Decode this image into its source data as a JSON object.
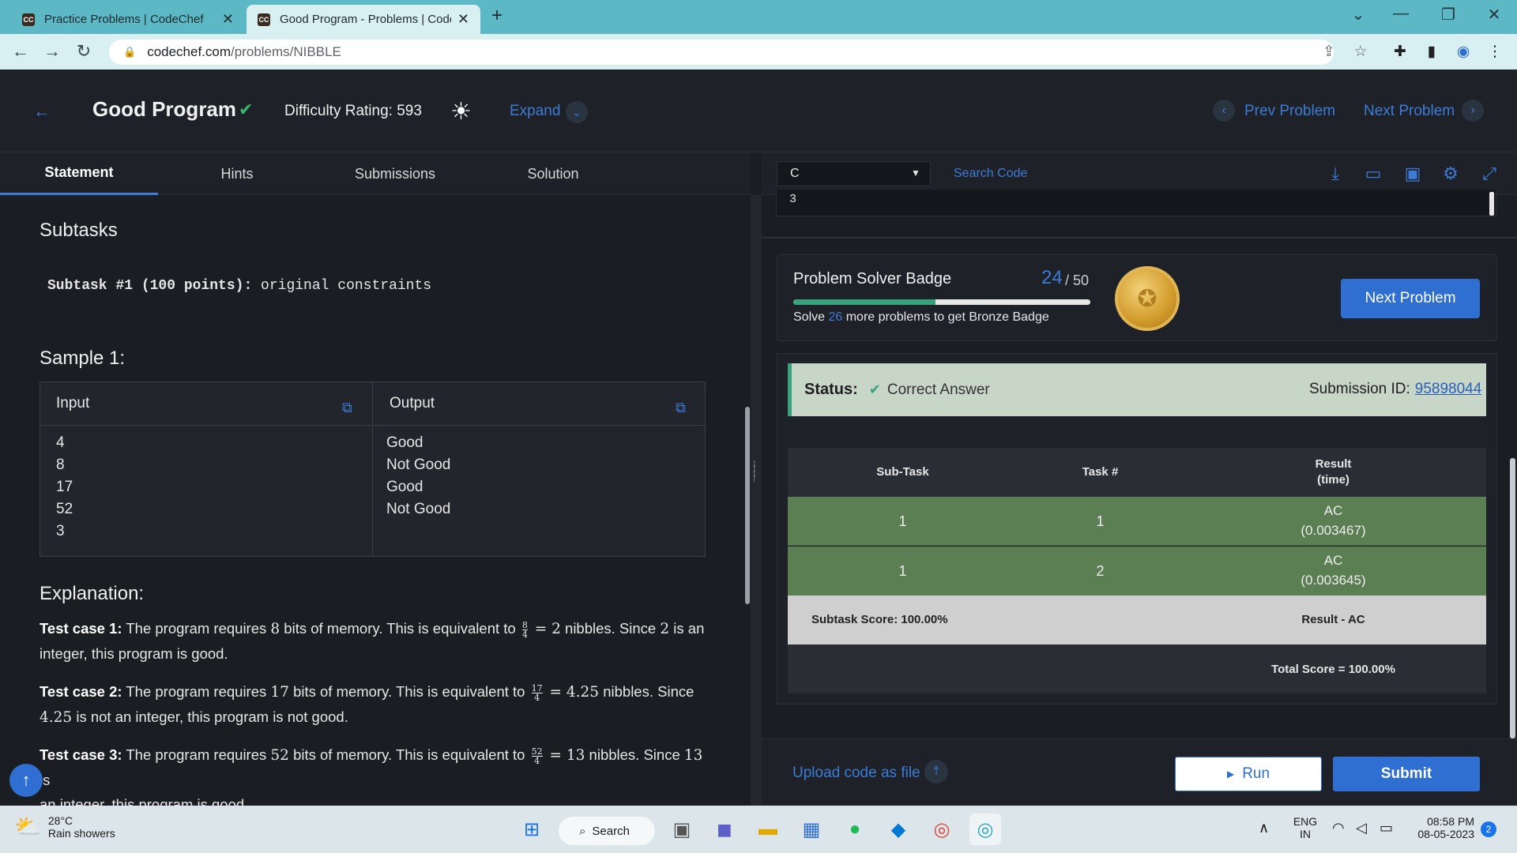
{
  "browser": {
    "tabs": [
      {
        "title": "Practice Problems | CodeChef",
        "favicon": "CC"
      },
      {
        "title": "Good Program - Problems | CodeChef",
        "favicon": "CC"
      }
    ],
    "new_tab": "+",
    "url_host": "codechef.com",
    "url_path": "/problems/NIBBLE"
  },
  "header": {
    "title": "Good Program",
    "difficulty": "Difficulty Rating: 593",
    "expand": "Expand",
    "prev": "Prev Problem",
    "next": "Next Problem"
  },
  "left_tabs": [
    "Statement",
    "Hints",
    "Submissions",
    "Solution"
  ],
  "statement": {
    "subtasks_heading": "Subtasks",
    "subtask_line_bold": "Subtask #1 (100 points):",
    "subtask_line_rest": " original constraints",
    "sample_heading": "Sample 1:",
    "input_label": "Input",
    "output_label": "Output",
    "inputs": [
      "4",
      "8",
      "17",
      "52",
      "3"
    ],
    "outputs": [
      "Good",
      "Not Good",
      "Good",
      "Not Good"
    ],
    "explanation_heading": "Explanation:",
    "cases": [
      {
        "label": "Test case 1:",
        "bits": "8",
        "num": "8",
        "den": "4",
        "result": "2",
        "since": "2",
        "tail1": " is an",
        "tail2": "integer, this program is good."
      },
      {
        "label": "Test case 2:",
        "bits": "17",
        "num": "17",
        "den": "4",
        "result": "4.25",
        "since": "4.25",
        "tail1": "",
        "tail2": " is not an integer, this program is not good."
      },
      {
        "label": "Test case 3:",
        "bits": "52",
        "num": "52",
        "den": "4",
        "result": "13",
        "since": "13",
        "tail1": " is",
        "tail2": "an integer, this program is good."
      }
    ],
    "text_requires": " The program requires ",
    "text_bits": " bits of memory. This is equivalent to ",
    "text_nibbles": " nibbles. Since "
  },
  "editor": {
    "language": "C",
    "search_placeholder": "Search Code",
    "code_tail": "3"
  },
  "badge": {
    "title": "Problem Solver Badge",
    "count": "24",
    "of": "/ 50",
    "progress": 0.48,
    "sub_pre": "Solve ",
    "sub_n": "26",
    "sub_post": " more problems to get Bronze Badge",
    "next_button": "Next Problem"
  },
  "status": {
    "label": "Status:",
    "value": "Correct Answer",
    "submission_label": "Submission ID:",
    "submission_id": "95898044"
  },
  "results": {
    "headers": [
      "Sub-Task",
      "Task #",
      "Result\n(time)"
    ],
    "rows": [
      {
        "subtask": "1",
        "task": "1",
        "result": "AC",
        "time": "(0.003467)"
      },
      {
        "subtask": "1",
        "task": "2",
        "result": "AC",
        "time": "(0.003645)"
      }
    ],
    "subtask_score": "Subtask Score: 100.00%",
    "subtask_result": "Result - AC",
    "total": "Total Score = 100.00%"
  },
  "actions": {
    "upload": "Upload code as file",
    "run": "Run",
    "submit": "Submit"
  },
  "taskbar": {
    "temp": "28°C",
    "weather": "Rain showers",
    "search": "Search",
    "lang1": "ENG",
    "lang2": "IN",
    "time": "08:58 PM",
    "date": "08-05-2023",
    "notif": "2"
  },
  "colors": {
    "accent": "#2f6fd1",
    "success": "#35b86b",
    "ac_row": "#5b7f52"
  }
}
